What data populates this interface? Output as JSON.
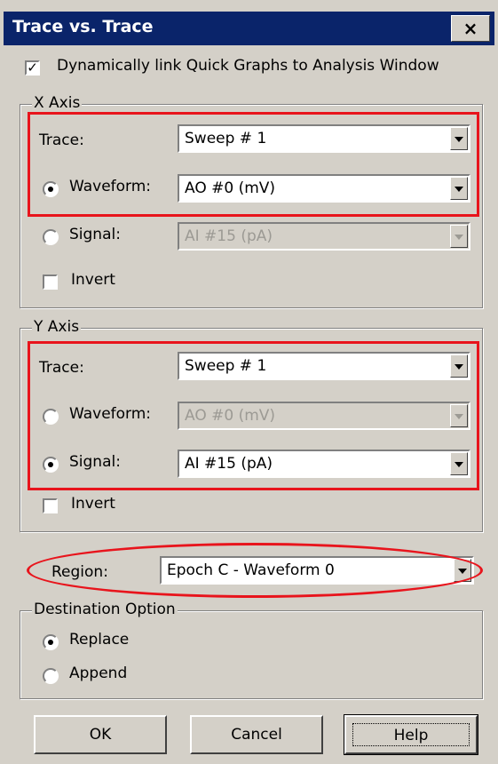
{
  "title": "Trace vs. Trace",
  "close_label": "×",
  "link_checkbox": {
    "label": "Dynamically link Quick Graphs to Analysis Window",
    "checked": true
  },
  "x_axis": {
    "group_label": "X Axis",
    "trace_label": "Trace:",
    "trace_value": "Sweep # 1",
    "waveform_label": "Waveform:",
    "waveform_value": "AO #0 (mV)",
    "waveform_selected": true,
    "signal_label": "Signal:",
    "signal_value": "AI #15 (pA)",
    "signal_selected": false,
    "invert_label": "Invert",
    "invert_checked": false
  },
  "y_axis": {
    "group_label": "Y Axis",
    "trace_label": "Trace:",
    "trace_value": "Sweep # 1",
    "waveform_label": "Waveform:",
    "waveform_value": "AO #0 (mV)",
    "waveform_selected": false,
    "signal_label": "Signal:",
    "signal_value": "AI #15 (pA)",
    "signal_selected": true,
    "invert_label": "Invert",
    "invert_checked": false
  },
  "region": {
    "label": "Region:",
    "value": "Epoch C - Waveform 0"
  },
  "destination": {
    "group_label": "Destination Option",
    "replace_label": "Replace",
    "append_label": "Append",
    "selected": "Replace"
  },
  "buttons": {
    "ok": "OK",
    "cancel": "Cancel",
    "help": "Help"
  },
  "colors": {
    "titlebar": "#0a246a",
    "dialog_bg": "#d4d0c8",
    "highlight": "#e8141c"
  }
}
